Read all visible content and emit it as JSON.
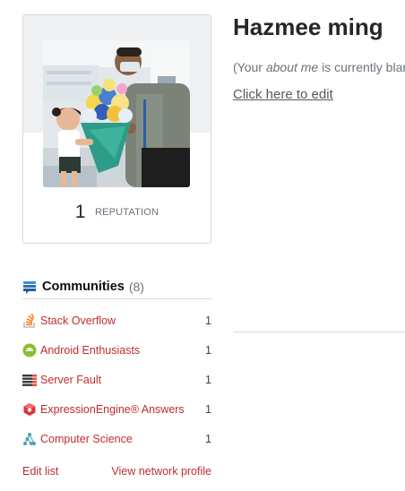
{
  "profile": {
    "name": "Hazmee ming",
    "reputation_value": "1",
    "reputation_label": "REPUTATION",
    "about_prefix": "(Your ",
    "about_emph": "about me",
    "about_suffix": " is currently blank.)",
    "edit_link": "Click here to edit"
  },
  "communities": {
    "title": "Communities",
    "count": "(8)",
    "items": [
      {
        "name": "Stack Overflow",
        "rep": "1",
        "icon": "stack-overflow-icon"
      },
      {
        "name": "Android Enthusiasts",
        "rep": "1",
        "icon": "android-icon"
      },
      {
        "name": "Server Fault",
        "rep": "1",
        "icon": "server-fault-icon"
      },
      {
        "name": "ExpressionEngine® Answers",
        "rep": "1",
        "icon": "expressionengine-icon"
      },
      {
        "name": "Computer Science",
        "rep": "1",
        "icon": "computer-science-icon"
      }
    ],
    "edit_list": "Edit list",
    "view_network": "View network profile"
  },
  "colors": {
    "link_red": "#c02d2e",
    "border": "#d6d9dc",
    "card_top": "#eff0f1"
  }
}
